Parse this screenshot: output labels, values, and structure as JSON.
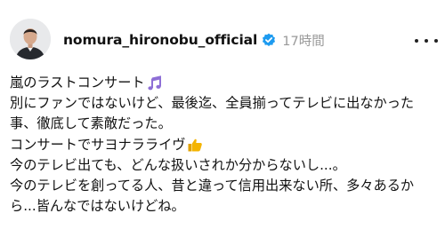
{
  "post": {
    "author": {
      "username": "nomura_hironobu_official",
      "verified": true,
      "timestamp": "17時間"
    },
    "icons": {
      "verified": "verified-badge-icon",
      "more": "more-options-icon",
      "music": "music-note-emoji",
      "thumbs": "thumbs-up-emoji"
    },
    "colors": {
      "verified_badge": "#1d9bf0",
      "music_emoji": "#8e6fd6",
      "thumbs_emoji": "#f4b400",
      "timestamp": "#9a9a9a"
    },
    "lines": [
      "嵐のラストコンサート",
      "別にファンではないけど、最後迄、全員揃ってテレビに出なかった",
      "事、徹底して素敵だった。",
      "コンサートでサヨナラライヴ",
      "今のテレビ出ても、どんな扱いされか分からないし...。",
      "今のテレビを創ってる人、昔と違って信用出来ない所、多々あるか",
      "ら...皆んなではないけどね。"
    ]
  }
}
